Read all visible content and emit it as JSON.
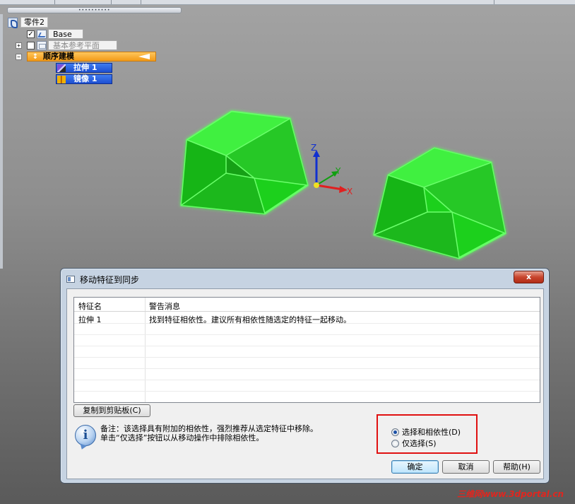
{
  "tree": {
    "root_label": "零件2",
    "items": [
      {
        "label": "Base",
        "checked": true
      },
      {
        "label": "基本参考平面",
        "checked": false,
        "expander": "+"
      }
    ],
    "sequence": {
      "label": "顺序建模",
      "expander": "−"
    },
    "features": [
      {
        "label": "拉伸 1"
      },
      {
        "label": "镜像 1"
      }
    ]
  },
  "scene": {
    "axes": {
      "x": "X",
      "y": "Y",
      "z": "Z"
    },
    "colors": {
      "solid": "#22dd22",
      "edge": "#55ff55",
      "x_axis": "#e02020",
      "y_axis": "#10a010",
      "z_axis": "#1030d0"
    }
  },
  "dialog": {
    "title": "移动特征到同步",
    "close_label": "x",
    "table": {
      "headers": [
        "特征名",
        "警告消息"
      ],
      "rows": [
        {
          "name": "拉伸 1",
          "message": "找到特征相依性。建议所有相依性随选定的特征一起移动。"
        }
      ]
    },
    "copy_button": "复制到剪贴板(C)",
    "note_line1": "备注：该选择具有附加的相依性，强烈推荐从选定特征中移除。",
    "note_line2": "单击“仅选择”按钮以从移动操作中排除相依性。",
    "options": [
      {
        "label": "选择和相依性(D)",
        "selected": true
      },
      {
        "label": "仅选择(S)",
        "selected": false
      }
    ],
    "buttons": {
      "ok": "确定",
      "cancel": "取消",
      "help": "帮助(H)"
    }
  },
  "watermark": "三维网www.3dportal.cn"
}
